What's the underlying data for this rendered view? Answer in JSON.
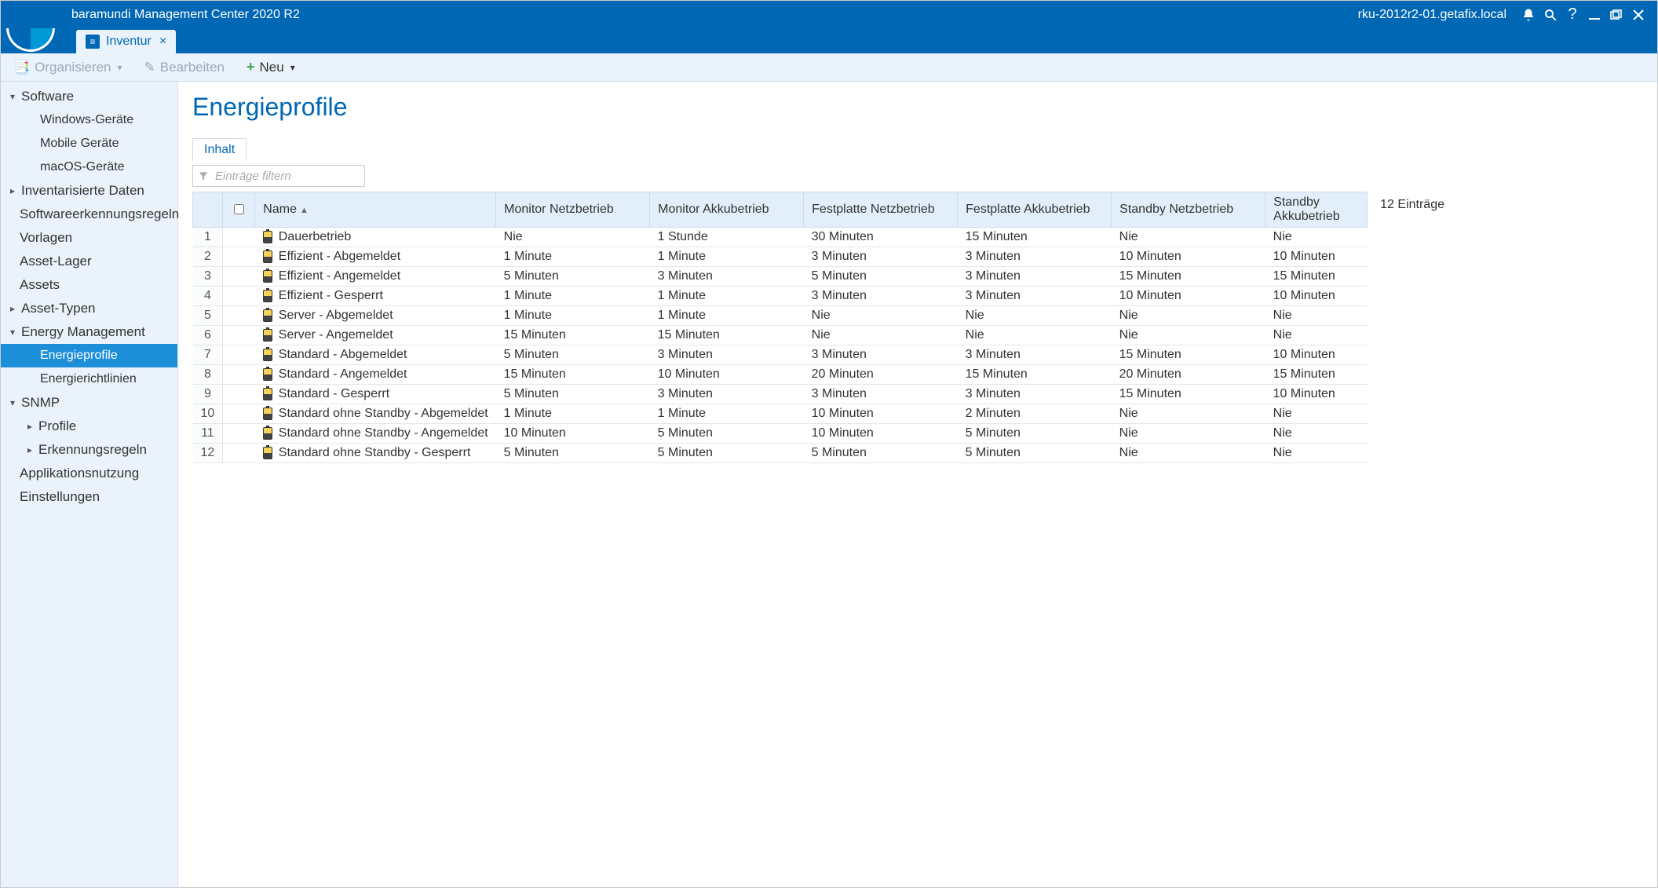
{
  "header": {
    "app_title": "baramundi Management Center 2020 R2",
    "host": "rku-2012r2-01.getafix.local"
  },
  "tab": {
    "label": "Inventur"
  },
  "toolbar": {
    "organize": "Organisieren",
    "edit": "Bearbeiten",
    "neu": "Neu"
  },
  "sidebar": [
    {
      "label": "Software",
      "chev": "▾",
      "lvl": 0
    },
    {
      "label": "Windows-Geräte",
      "lvl": 2
    },
    {
      "label": "Mobile Geräte",
      "lvl": 2
    },
    {
      "label": "macOS-Geräte",
      "lvl": 2
    },
    {
      "label": "Inventarisierte Daten",
      "chev": "▸",
      "lvl": 0
    },
    {
      "label": "Softwareerkennungsregeln",
      "lvl": 1
    },
    {
      "label": "Vorlagen",
      "lvl": 1
    },
    {
      "label": "Asset-Lager",
      "lvl": 1
    },
    {
      "label": "Assets",
      "lvl": 1
    },
    {
      "label": "Asset-Typen",
      "chev": "▸",
      "lvl": 0
    },
    {
      "label": "Energy Management",
      "chev": "▾",
      "lvl": 0
    },
    {
      "label": "Energieprofile",
      "lvl": 2,
      "selected": true
    },
    {
      "label": "Energierichtlinien",
      "lvl": 2
    },
    {
      "label": "SNMP",
      "chev": "▾",
      "lvl": 0
    },
    {
      "label": "Profile",
      "chev": "▸",
      "lvl": 1,
      "indent_extra": true
    },
    {
      "label": "Erkennungsregeln",
      "chev": "▸",
      "lvl": 1,
      "indent_extra": true
    },
    {
      "label": "Applikationsnutzung",
      "lvl": 1
    },
    {
      "label": "Einstellungen",
      "lvl": 1
    }
  ],
  "page": {
    "title": "Energieprofile",
    "subtab": "Inhalt",
    "filter_placeholder": "Einträge filtern",
    "count_label": "12 Einträge"
  },
  "columns": [
    "Name",
    "Monitor Netzbetrieb",
    "Monitor Akkubetrieb",
    "Festplatte Netzbetrieb",
    "Festplatte Akkubetrieb",
    "Standby Netzbetrieb",
    "Standby Akkubetrieb"
  ],
  "rows": [
    {
      "n": "1",
      "name": "Dauerbetrieb",
      "c": [
        "Nie",
        "1 Stunde",
        "30 Minuten",
        "15 Minuten",
        "Nie",
        "Nie"
      ]
    },
    {
      "n": "2",
      "name": "Effizient - Abgemeldet",
      "c": [
        "1 Minute",
        "1 Minute",
        "3 Minuten",
        "3 Minuten",
        "10 Minuten",
        "10 Minuten"
      ]
    },
    {
      "n": "3",
      "name": "Effizient - Angemeldet",
      "c": [
        "5 Minuten",
        "3 Minuten",
        "5 Minuten",
        "3 Minuten",
        "15 Minuten",
        "15 Minuten"
      ]
    },
    {
      "n": "4",
      "name": "Effizient - Gesperrt",
      "c": [
        "1 Minute",
        "1 Minute",
        "3 Minuten",
        "3 Minuten",
        "10 Minuten",
        "10 Minuten"
      ]
    },
    {
      "n": "5",
      "name": "Server - Abgemeldet",
      "c": [
        "1 Minute",
        "1 Minute",
        "Nie",
        "Nie",
        "Nie",
        "Nie"
      ]
    },
    {
      "n": "6",
      "name": "Server - Angemeldet",
      "c": [
        "15 Minuten",
        "15 Minuten",
        "Nie",
        "Nie",
        "Nie",
        "Nie"
      ]
    },
    {
      "n": "7",
      "name": "Standard - Abgemeldet",
      "c": [
        "5 Minuten",
        "3 Minuten",
        "3 Minuten",
        "3 Minuten",
        "15 Minuten",
        "10 Minuten"
      ]
    },
    {
      "n": "8",
      "name": "Standard - Angemeldet",
      "c": [
        "15 Minuten",
        "10 Minuten",
        "20 Minuten",
        "15 Minuten",
        "20 Minuten",
        "15 Minuten"
      ]
    },
    {
      "n": "9",
      "name": "Standard - Gesperrt",
      "c": [
        "5 Minuten",
        "3 Minuten",
        "3 Minuten",
        "3 Minuten",
        "15 Minuten",
        "10 Minuten"
      ]
    },
    {
      "n": "10",
      "name": "Standard ohne Standby - Abgemeldet",
      "c": [
        "1 Minute",
        "1 Minute",
        "10 Minuten",
        "2 Minuten",
        "Nie",
        "Nie"
      ]
    },
    {
      "n": "11",
      "name": "Standard ohne Standby - Angemeldet",
      "c": [
        "10 Minuten",
        "5 Minuten",
        "10 Minuten",
        "5 Minuten",
        "Nie",
        "Nie"
      ]
    },
    {
      "n": "12",
      "name": "Standard ohne Standby - Gesperrt",
      "c": [
        "5 Minuten",
        "5 Minuten",
        "5 Minuten",
        "5 Minuten",
        "Nie",
        "Nie"
      ]
    }
  ]
}
